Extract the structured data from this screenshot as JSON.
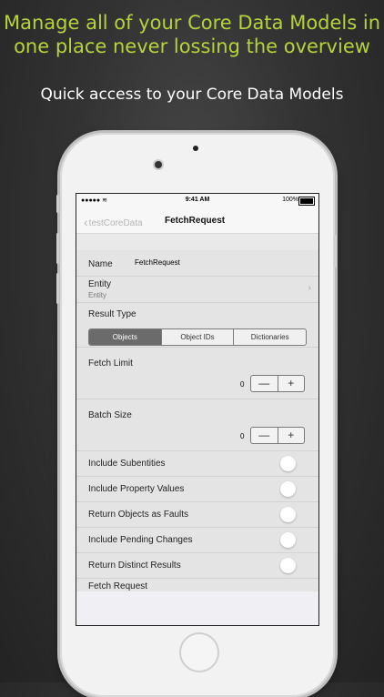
{
  "promo": {
    "headline_line1": "Manage all of your Core Data Models in",
    "headline_line2": "one place never lossing the overview",
    "subheadline": "Quick access to your Core Data Models"
  },
  "status_bar": {
    "signal": "●●●●● ",
    "time": "9:41 AM",
    "battery": "100%"
  },
  "nav": {
    "back_label": "testCoreData",
    "title": "FetchRequest"
  },
  "form": {
    "name_label": "Name",
    "name_value": "FetchRequest",
    "entity_label": "Entity",
    "entity_placeholder": "Entity",
    "result_type_label": "Result Type",
    "result_type_options": [
      "Objects",
      "Object IDs",
      "Dictionaries"
    ],
    "result_type_selected": "Objects",
    "fetch_limit_label": "Fetch Limit",
    "fetch_limit_value": "0",
    "batch_size_label": "Batch Size",
    "batch_size_value": "0",
    "stepper_minus": "—",
    "stepper_plus": "+",
    "toggles": [
      {
        "label": "Include Subentities",
        "on": false
      },
      {
        "label": "Include Property Values",
        "on": false
      },
      {
        "label": "Return Objects as Faults",
        "on": false
      },
      {
        "label": "Include Pending Changes",
        "on": false
      },
      {
        "label": "Return Distinct Results",
        "on": false
      }
    ],
    "fetch_request_label": "Fetch Request"
  },
  "colors": {
    "headline": "#b5d33a",
    "selected_segment": "#6b6b6b"
  },
  "icons": {
    "back": "chevron-left-icon",
    "entity_disclosure": "chevron-right-icon",
    "wifi": "wifi-icon",
    "battery": "battery-icon"
  }
}
